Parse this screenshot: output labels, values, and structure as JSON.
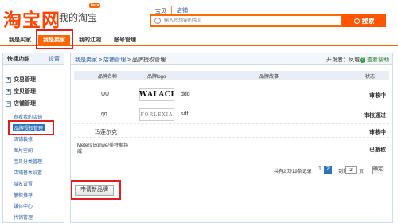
{
  "header": {
    "logo_text": "淘宝网",
    "logo_sub": "我的淘宝",
    "beta": "beta",
    "search_tabs": [
      "宝贝",
      "店铺"
    ],
    "search_placeholder": "输入您想要的宝贝",
    "search_button": "搜索"
  },
  "nav": {
    "items": [
      "我是买家",
      "我是卖家",
      "我的江湖",
      "账号管理"
    ]
  },
  "sidebar": {
    "title": "快捷功能",
    "settings": "设置",
    "sections": [
      "交易管理",
      "宝贝管理",
      "店铺管理"
    ],
    "links": [
      "查看我的店铺",
      "品牌授权管理",
      "店铺装修",
      "图片空间",
      "宝贝分类管理",
      "店铺基本设置",
      "域名设置",
      "掌柜推荐",
      "媒体中心",
      "代销管理"
    ]
  },
  "breadcrumb": {
    "items": [
      "我是卖家",
      "店铺管理",
      "品牌授权管理"
    ],
    "sep": ">"
  },
  "developer": "开发者：凤城",
  "help": "查看帮助",
  "table": {
    "headers": [
      "品牌名称",
      "品牌logo",
      "品牌故事",
      "状态"
    ],
    "rows": [
      {
        "name": "UU",
        "logo": "WALACI",
        "story": "ddd",
        "status": "审核中"
      },
      {
        "name": "qq",
        "logo": "FORLEXIA",
        "story": "sdf",
        "status": "审核通过"
      },
      {
        "name": "玛莲尔克",
        "logo": "",
        "story": "",
        "status": "审核中"
      },
      {
        "name": "Meters Bonwe/美特斯邦威",
        "logo": "",
        "story": "",
        "status": "已授权"
      }
    ]
  },
  "pager": {
    "summary": "共有2页/19条记录",
    "pages": [
      "1",
      "2"
    ],
    "goto_label": "到第",
    "goto_value": "2",
    "page_unit": "页",
    "confirm": "确定"
  },
  "apply_button": "申请新品牌",
  "colors": {
    "brand": "#ff5500",
    "link": "#2a5fa0",
    "selected": "#2f73b9",
    "highlight": "#e02020"
  }
}
